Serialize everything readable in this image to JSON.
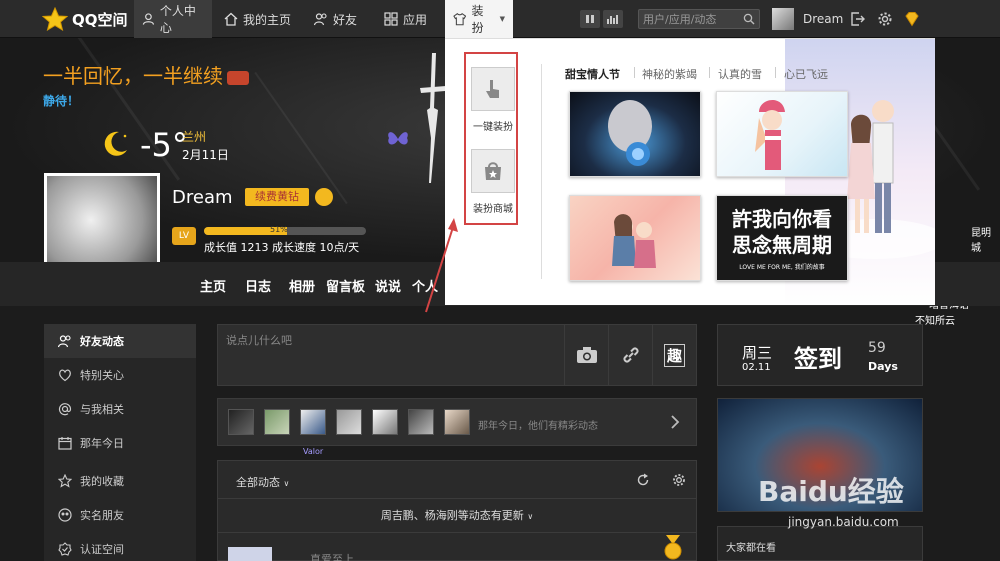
{
  "topbar": {
    "logo_text": "QQ空间",
    "tabs": [
      {
        "label": "个人中心"
      },
      {
        "label": "我的主页"
      },
      {
        "label": "好友"
      },
      {
        "label": "应用"
      },
      {
        "label": "装扮"
      }
    ],
    "search_placeholder": "用户/应用/动态",
    "username": "Dream"
  },
  "profile": {
    "motto": "一半回忆，一半继续",
    "status": "静待！",
    "temperature": "-5°",
    "city": "兰州",
    "date": "2月11日",
    "name": "Dream",
    "vip_button": "续费黄钻",
    "level_badge": "LV",
    "progress_percent": 51,
    "progress_text": "51%",
    "growth_text": "成长值 1213   成长速度 10点/天"
  },
  "subnav": {
    "items": [
      "主页",
      "日志",
      "相册",
      "留言板",
      "说说",
      "个人"
    ]
  },
  "dress_popup": {
    "quick_items": [
      {
        "label": "一键装扮"
      },
      {
        "label": "装扮商城"
      }
    ],
    "theme_tabs": [
      "甜宝情人节",
      "神秘的紫竭",
      "认真的雪",
      "心已飞远"
    ],
    "thumb_text_line1": "許我向你看",
    "thumb_text_line2": "思念無周期",
    "thumb_sub": "LOVE ME FOR ME, 我们的故事"
  },
  "hero_right": {
    "city_text": "昆明城",
    "song_text": "暗普洱语",
    "artist_text": "不知所云"
  },
  "left_nav": {
    "items": [
      {
        "label": "好友动态"
      },
      {
        "label": "特别关心"
      },
      {
        "label": "与我相关"
      },
      {
        "label": "那年今日"
      },
      {
        "label": "我的收藏"
      },
      {
        "label": "实名朋友"
      },
      {
        "label": "认证空间"
      }
    ]
  },
  "post": {
    "placeholder": "说点儿什么吧",
    "fun_label": "趣"
  },
  "friends_row": {
    "hint": "那年今日，他们有精彩动态",
    "valor": "Valor"
  },
  "feed": {
    "filter": "全部动态",
    "update_text": "周吉鹏、杨海刚等动态有更新",
    "first_name": "真爱至上"
  },
  "checkin": {
    "day": "周三",
    "date": "02.11",
    "label": "签到",
    "count": "59",
    "unit": "Days"
  },
  "everyone": {
    "title": "大家都在看"
  },
  "watermark": {
    "brand": "Baidu经验",
    "url": "jingyan.baidu.com"
  },
  "colors": {
    "accent_gold": "#f3b81f",
    "motto_orange": "#f3a020",
    "status_blue": "#3da8e8",
    "highlight_red": "#d34444"
  }
}
